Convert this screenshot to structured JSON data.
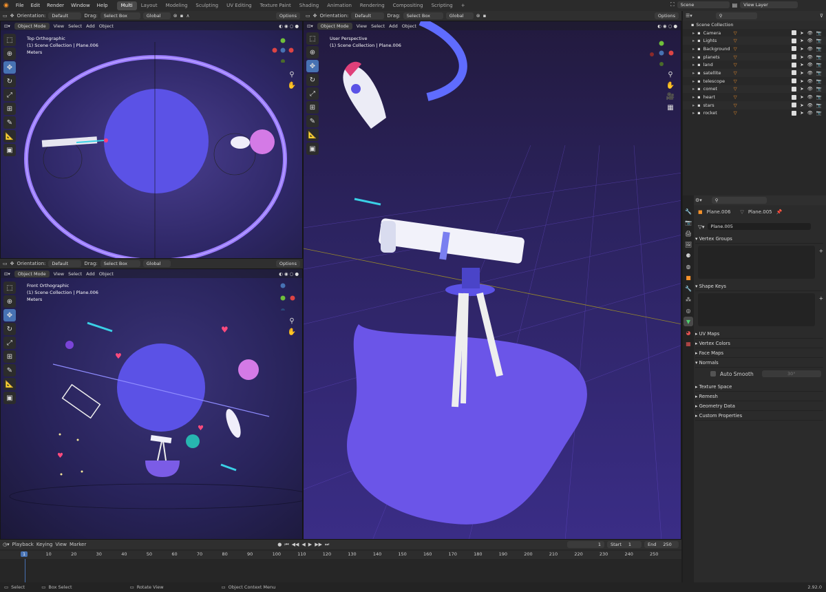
{
  "menu": [
    "File",
    "Edit",
    "Render",
    "Window",
    "Help"
  ],
  "workspaces": [
    "Multi",
    "Layout",
    "Modeling",
    "Sculpting",
    "UV Editing",
    "Texture Paint",
    "Shading",
    "Animation",
    "Rendering",
    "Compositing",
    "Scripting"
  ],
  "scene": {
    "label": "Scene",
    "view_layer": "View Layer"
  },
  "toolbar": {
    "orientation_label": "Orientation:",
    "orientation_value": "Default",
    "drag_label": "Drag:",
    "drag_value": "Select Box",
    "transform_value": "Global",
    "options": "Options"
  },
  "viewport_menu": {
    "mode": "Object Mode",
    "view": "View",
    "select": "Select",
    "add": "Add",
    "object": "Object"
  },
  "vp_top": {
    "view": "Top Orthographic",
    "collection": "(1) Scene Collection | Plane.006",
    "units": "Meters"
  },
  "vp_front": {
    "view": "Front Orthographic",
    "collection": "(1) Scene Collection | Plane.006",
    "units": "Meters"
  },
  "vp_persp": {
    "view": "User Perspective",
    "collection": "(1) Scene Collection | Plane.006"
  },
  "outliner": {
    "root": "Scene Collection",
    "items": [
      "Camera",
      "Lights",
      "Background",
      "planets",
      "land",
      "satellite",
      "telescope",
      "comet",
      "heart",
      "stars",
      "rocket"
    ]
  },
  "properties": {
    "object_name": "Plane.006",
    "mesh_name": "Plane.005",
    "data_field": "Plane.005",
    "vertex_groups": "Vertex Groups",
    "shape_keys": "Shape Keys",
    "uv_maps": "UV Maps",
    "vertex_colors": "Vertex Colors",
    "face_maps": "Face Maps",
    "normals": "Normals",
    "auto_smooth": "Auto Smooth",
    "auto_smooth_angle": "30°",
    "texture_space": "Texture Space",
    "remesh": "Remesh",
    "geometry_data": "Geometry Data",
    "custom_props": "Custom Properties"
  },
  "timeline": {
    "playback": "Playback",
    "keying": "Keying",
    "view": "View",
    "marker": "Marker",
    "current": "1",
    "start_label": "Start",
    "start": "1",
    "end_label": "End",
    "end": "250",
    "frames": [
      "1",
      "10",
      "20",
      "30",
      "40",
      "50",
      "60",
      "70",
      "80",
      "90",
      "100",
      "110",
      "120",
      "130",
      "140",
      "150",
      "160",
      "170",
      "180",
      "190",
      "200",
      "210",
      "220",
      "230",
      "240",
      "250"
    ]
  },
  "status": {
    "select": "Select",
    "box_select": "Box Select",
    "rotate_view": "Rotate View",
    "context_menu": "Object Context Menu",
    "version": "2.92.0"
  },
  "colors": {
    "accent": "#4772b3",
    "viewport_bg": "#2a2550",
    "planet": "#5b52e6",
    "ring": "#9b7cff",
    "pink": "#e0407a"
  }
}
